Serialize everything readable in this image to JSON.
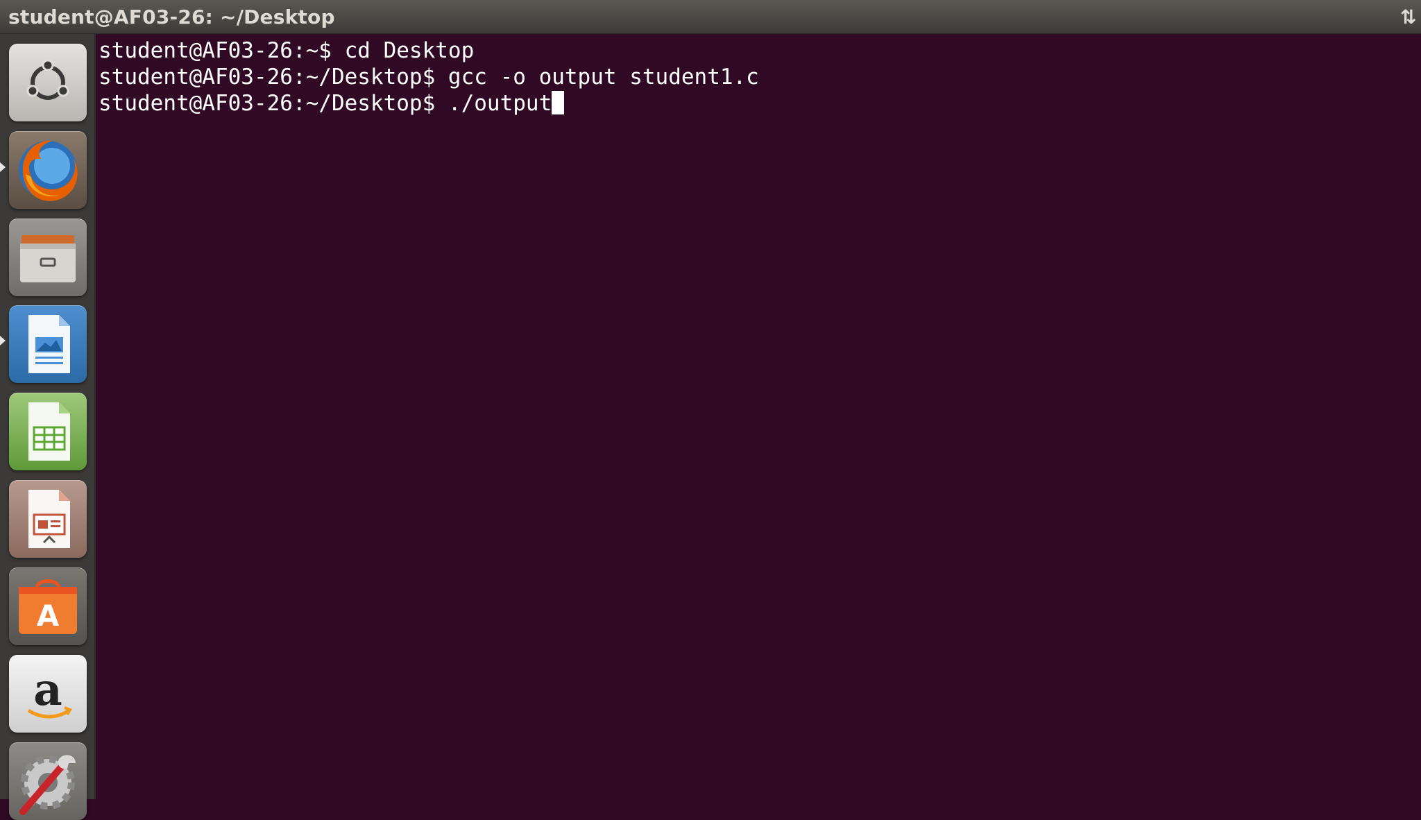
{
  "window": {
    "title": "student@AF03-26: ~/Desktop",
    "tray_icon": "network-arrows-icon"
  },
  "launcher": {
    "items": [
      {
        "name": "ubuntu-dash-icon",
        "color": "#d8d6d3",
        "active": false
      },
      {
        "name": "firefox-icon",
        "color": "#e66000",
        "active": true
      },
      {
        "name": "files-icon",
        "color": "#c9c6c1",
        "active": false
      },
      {
        "name": "libreoffice-writer-icon",
        "color": "#4a90d9",
        "active": true
      },
      {
        "name": "libreoffice-calc-icon",
        "color": "#5aa832",
        "active": false
      },
      {
        "name": "libreoffice-impress-icon",
        "color": "#c0543a",
        "active": false
      },
      {
        "name": "software-center-icon",
        "color": "#e95420",
        "active": false
      },
      {
        "name": "amazon-icon",
        "color": "#f0f0f0",
        "active": false
      },
      {
        "name": "system-settings-icon",
        "color": "#b0b0b0",
        "active": false
      }
    ]
  },
  "terminal": {
    "background": "#300a24",
    "lines": [
      {
        "prompt": "student@AF03-26:~$ ",
        "command": "cd Desktop"
      },
      {
        "prompt": "student@AF03-26:~/Desktop$ ",
        "command": "gcc -o output student1.c"
      },
      {
        "prompt": "student@AF03-26:~/Desktop$ ",
        "command": "./output"
      }
    ]
  }
}
